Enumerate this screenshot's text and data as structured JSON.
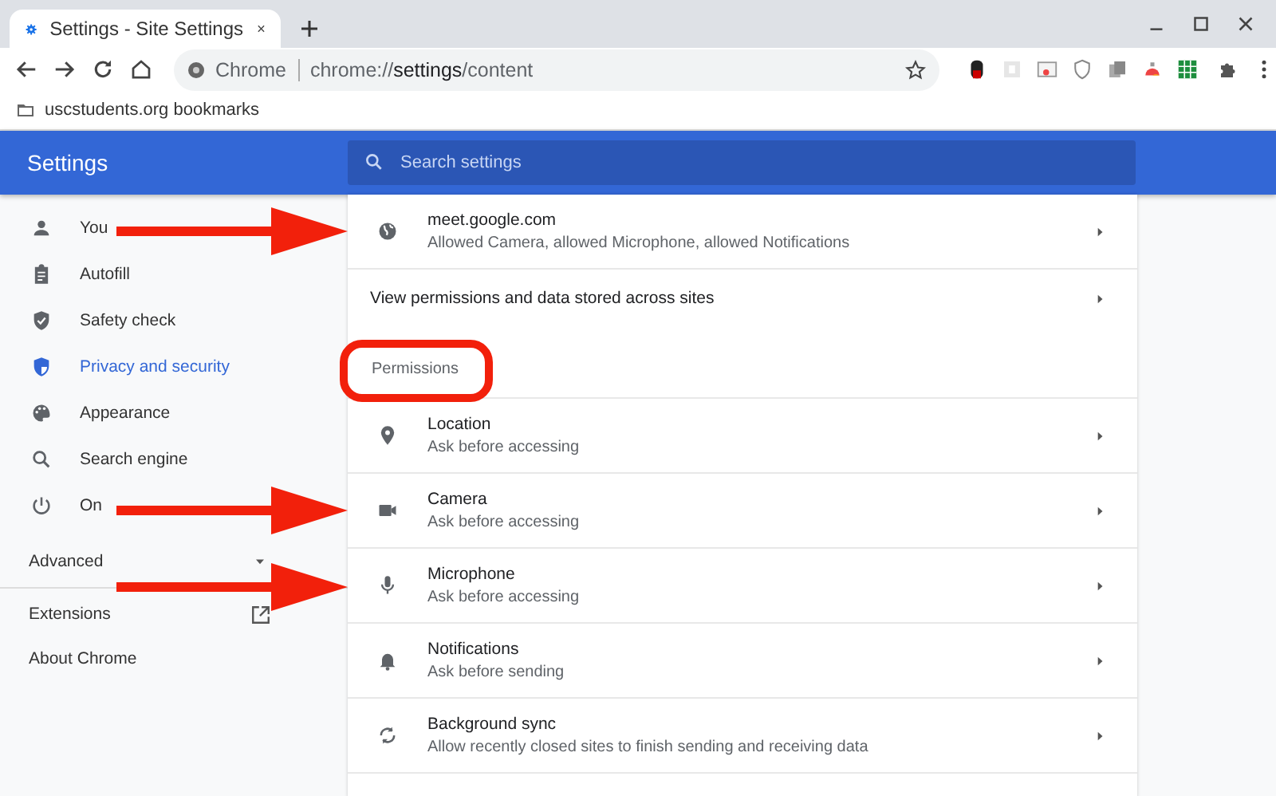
{
  "tab": {
    "title": "Settings - Site Settings",
    "selected": true
  },
  "address_bar": {
    "origin": "Chrome",
    "url": "chrome://**settings**/content"
  },
  "bookmarks": [
    "uscstudents.org bookmarks"
  ],
  "header": {
    "title": "Settings",
    "search": {
      "placeholder": "Search settings"
    }
  },
  "sidebar": {
    "items": [
      {
        "kind": "person",
        "label": "You",
        "selected": false
      },
      {
        "kind": "clipboard",
        "label": "Autofill",
        "selected": false
      },
      {
        "kind": "shield",
        "label": "Safety check",
        "selected": false
      },
      {
        "kind": "privacy",
        "label": "Privacy and security",
        "selected": true
      },
      {
        "kind": "palette",
        "label": "Appearance",
        "selected": false
      },
      {
        "kind": "search",
        "label": "Search engine",
        "selected": false
      },
      {
        "kind": "power",
        "label": "On",
        "selected": false
      }
    ],
    "advanced": {
      "label": "Advanced",
      "expanded": false
    },
    "links": [
      {
        "label": "Extensions",
        "external": true
      },
      {
        "label": "About Chrome",
        "external": false
      }
    ]
  },
  "content": {
    "site": {
      "title": "meet.google.com",
      "subtitle": "Allowed Camera, allowed Microphone, allowed Notifications"
    },
    "view_all": "View permissions and data stored across sites",
    "section": "Permissions",
    "permissions": [
      {
        "kind": "location",
        "title": "Location",
        "subtitle": "Ask before accessing"
      },
      {
        "kind": "camera",
        "title": "Camera",
        "subtitle": "Ask before accessing"
      },
      {
        "kind": "microphone",
        "title": "Microphone",
        "subtitle": "Ask before accessing"
      },
      {
        "kind": "bell",
        "title": "Notifications",
        "subtitle": "Ask before sending"
      },
      {
        "kind": "sync",
        "title": "Background sync",
        "subtitle": "Allow recently closed sites to finish sending and receiving data"
      }
    ]
  }
}
